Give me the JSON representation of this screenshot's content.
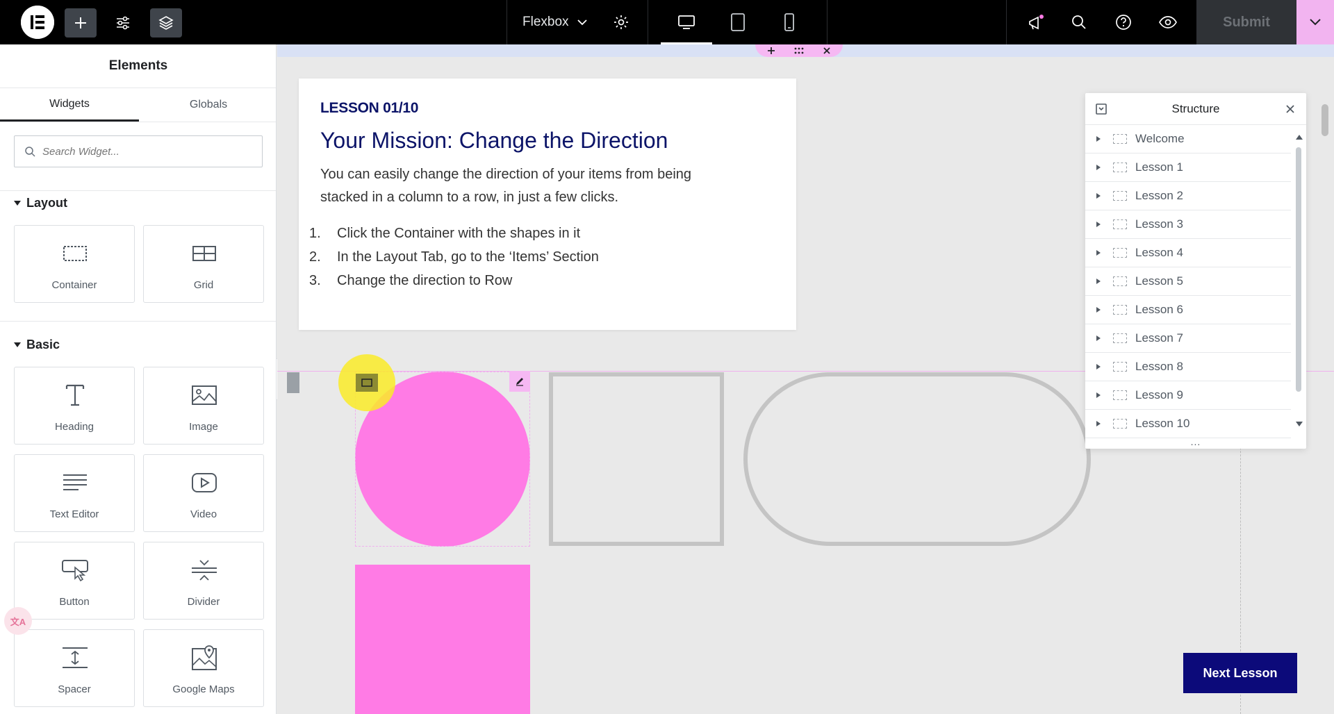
{
  "topbar": {
    "flexbox_label": "Flexbox",
    "submit_label": "Submit"
  },
  "panel": {
    "title": "Elements",
    "tabs": [
      {
        "label": "Widgets"
      },
      {
        "label": "Globals"
      }
    ],
    "search_placeholder": "Search Widget...",
    "sections": {
      "layout": "Layout",
      "basic": "Basic"
    },
    "layout_widgets": [
      {
        "label": "Container",
        "icon": "container-icon"
      },
      {
        "label": "Grid",
        "icon": "grid-icon"
      }
    ],
    "basic_widgets": [
      {
        "label": "Heading",
        "icon": "heading-icon"
      },
      {
        "label": "Image",
        "icon": "image-icon"
      },
      {
        "label": "Text Editor",
        "icon": "text-editor-icon"
      },
      {
        "label": "Video",
        "icon": "video-icon"
      },
      {
        "label": "Button",
        "icon": "button-icon"
      },
      {
        "label": "Divider",
        "icon": "divider-icon"
      },
      {
        "label": "Spacer",
        "icon": "spacer-icon"
      },
      {
        "label": "Google Maps",
        "icon": "google-maps-icon"
      }
    ],
    "translate_badge": "文A"
  },
  "lesson": {
    "kicker": "LESSON 01/10",
    "title": "Your Mission: Change the Direction",
    "body": "You can easily change the direction of your items from being stacked in a column to a row, in just a few clicks.",
    "steps": [
      {
        "num": "1.",
        "text": "Click the Container with the shapes in it"
      },
      {
        "num": "2.",
        "text": "In the Layout Tab, go to the ‘Items’ Section"
      },
      {
        "num": "3.",
        "text": "Change the direction to Row"
      }
    ]
  },
  "next_lesson_label": "Next Lesson",
  "structure": {
    "title": "Structure",
    "items": [
      {
        "label": "Welcome"
      },
      {
        "label": "Lesson 1"
      },
      {
        "label": "Lesson 2"
      },
      {
        "label": "Lesson 3"
      },
      {
        "label": "Lesson 4"
      },
      {
        "label": "Lesson 5"
      },
      {
        "label": "Lesson 6"
      },
      {
        "label": "Lesson 7"
      },
      {
        "label": "Lesson 8"
      },
      {
        "label": "Lesson 9"
      },
      {
        "label": "Lesson 10"
      }
    ],
    "more": "..."
  },
  "colors": {
    "accent_pink": "#ff7be5",
    "lesson_navy": "#0c1468",
    "next_button": "#0c0a7a"
  }
}
